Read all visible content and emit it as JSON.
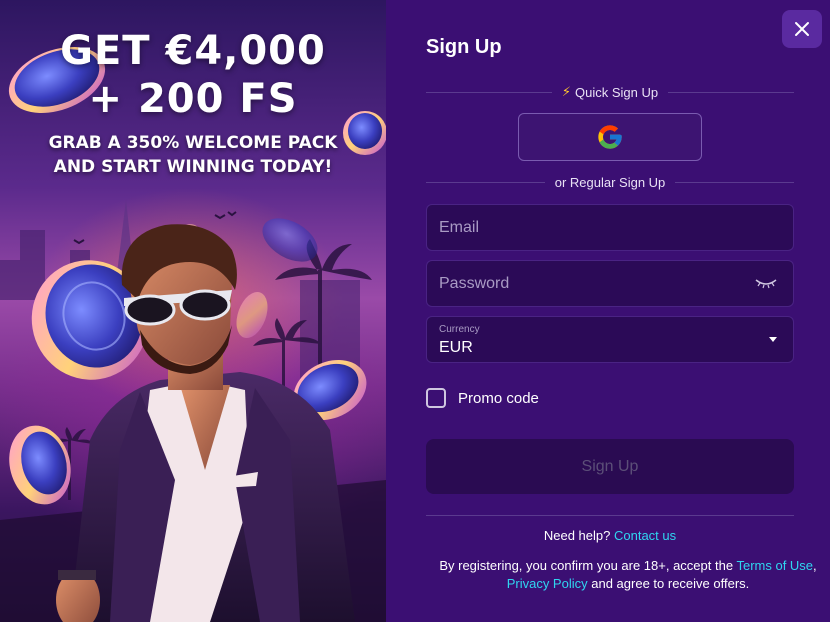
{
  "promo": {
    "headline_line1": "GET €4,000",
    "headline_line2": "+ 200 FS",
    "sub_line1": "GRAB A 350% WELCOME PACK",
    "sub_line2": "AND START WINNING TODAY!"
  },
  "signup": {
    "title": "Sign Up",
    "close_icon": "close-icon",
    "quick_label": "Quick Sign Up",
    "quick_icon": "lightning-icon",
    "google_icon": "google-icon",
    "regular_label": "or Regular Sign Up",
    "email": {
      "placeholder": "Email",
      "value": ""
    },
    "password": {
      "placeholder": "Password",
      "value": "",
      "icon": "eye-closed-icon"
    },
    "currency": {
      "label": "Currency",
      "value": "EUR"
    },
    "promo_code_label": "Promo code",
    "submit_label": "Sign Up",
    "help_text": "Need help?",
    "help_link": "Contact us",
    "legal_prefix": "By registering, you confirm you are 18+, accept the",
    "terms_link": "Terms of Use",
    "privacy_link": "Privacy Policy",
    "legal_suffix": "and agree to receive offers."
  },
  "colors": {
    "panel_bg": "#3b0f73",
    "field_bg": "#2b0a57",
    "link": "#30d5f0",
    "accent_bolt": "#ffc530"
  }
}
